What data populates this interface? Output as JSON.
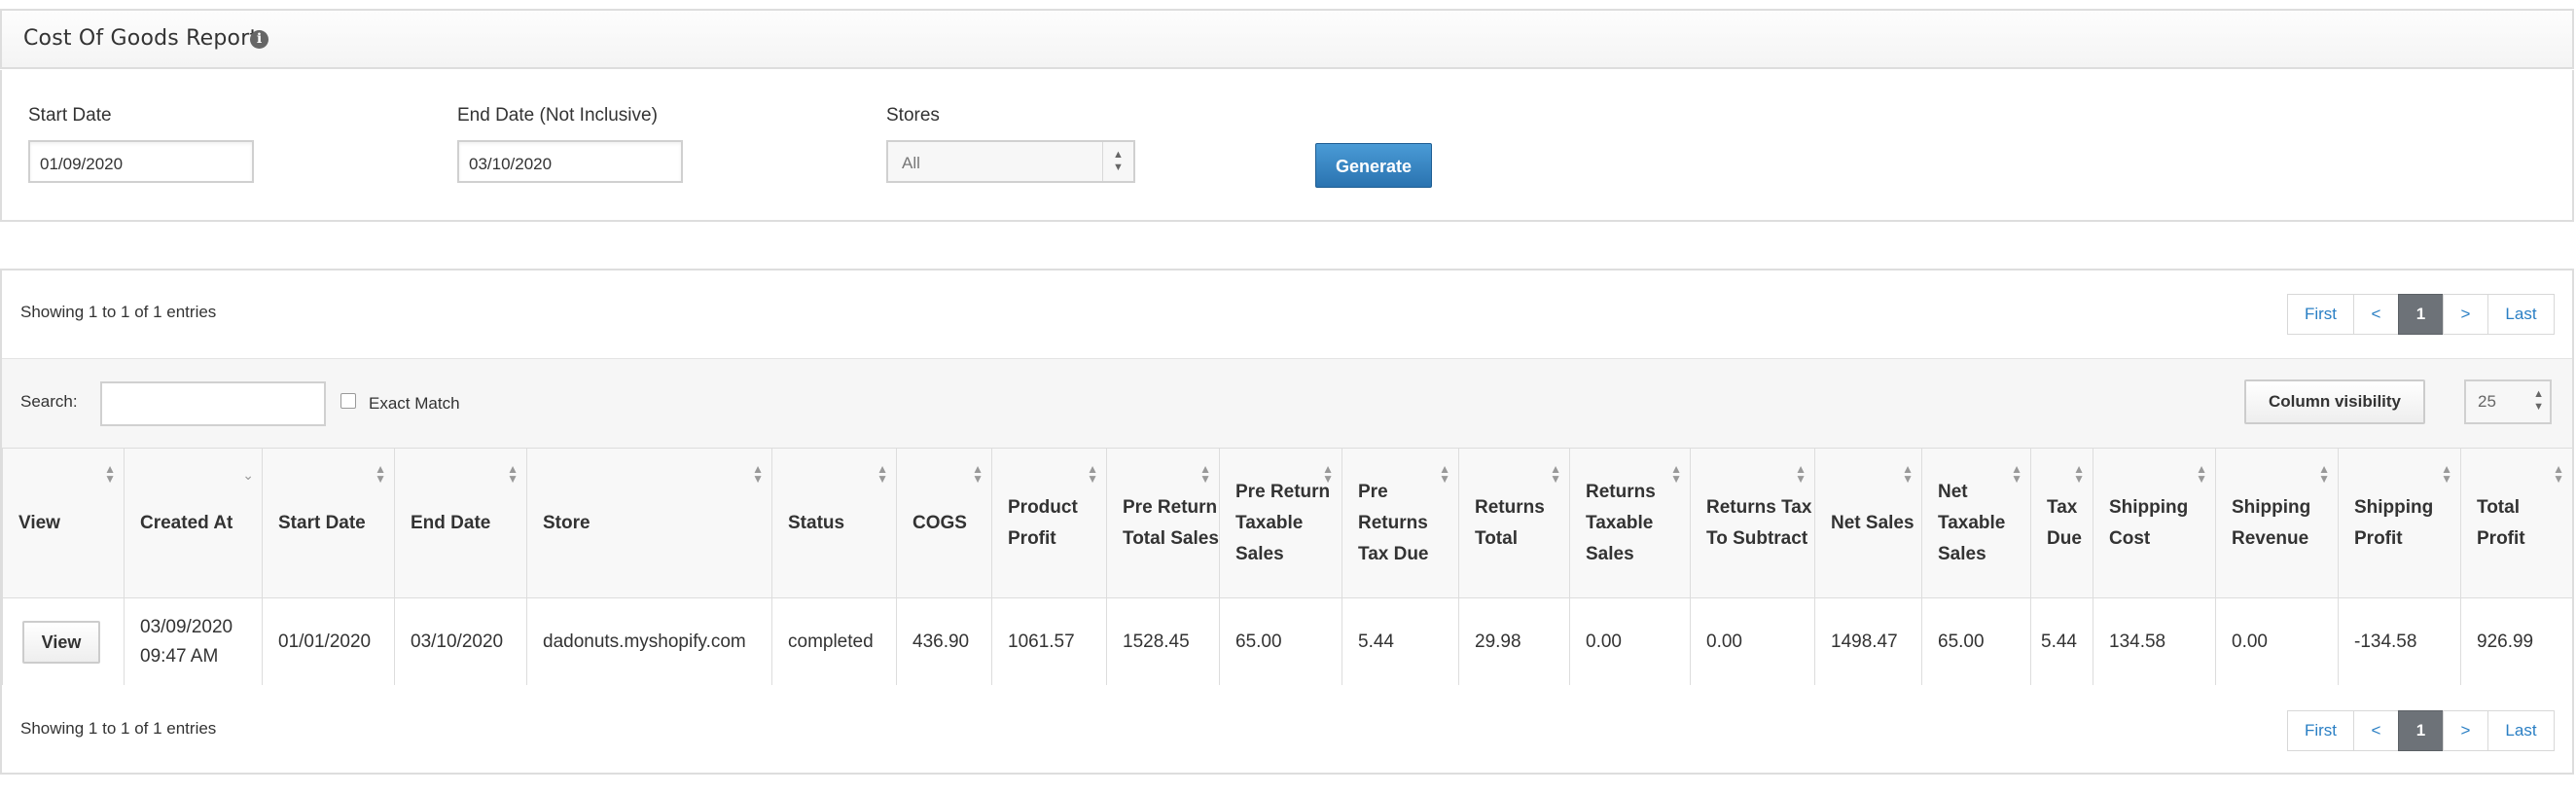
{
  "header": {
    "title": "Cost Of Goods Report",
    "info_icon": "info-icon"
  },
  "form": {
    "start_label": "Start Date",
    "start_value": "01/09/2020",
    "end_label": "End Date (Not Inclusive)",
    "end_value": "03/10/2020",
    "stores_label": "Stores",
    "stores_value": "All",
    "generate_label": "Generate"
  },
  "table": {
    "info_top": "Showing 1 to 1 of 1 entries",
    "info_bottom": "Showing 1 to 1 of 1 entries",
    "pager": {
      "first": "First",
      "prev": "<",
      "current": "1",
      "next": ">",
      "last": "Last"
    },
    "search_label": "Search:",
    "search_value": "",
    "exact_match_label": "Exact Match",
    "column_visibility_label": "Column visibility",
    "page_length": "25",
    "columns": [
      "View",
      "Created At",
      "Start Date",
      "End Date",
      "Store",
      "Status",
      "COGS",
      "Product Profit",
      "Pre Return Total Sales",
      "Pre Return Taxable Sales",
      "Pre Returns Tax Due",
      "Returns Total",
      "Returns Taxable Sales",
      "Returns Tax To Subtract",
      "Net Sales",
      "Net Taxable Sales",
      "Tax Due",
      "Shipping Cost",
      "Shipping Revenue",
      "Shipping Profit",
      "Total Profit"
    ],
    "rows": [
      {
        "view": "View",
        "created_date": "03/09/2020",
        "created_time": "09:47 AM",
        "start_date": "01/01/2020",
        "end_date": "03/10/2020",
        "store": "dadonuts.myshopify.com",
        "status": "completed",
        "cogs": "436.90",
        "product_profit": "1061.57",
        "pre_return_total_sales": "1528.45",
        "pre_return_taxable_sales": "65.00",
        "pre_returns_tax_due": "5.44",
        "returns_total": "29.98",
        "returns_taxable_sales": "0.00",
        "returns_tax_to_subtract": "0.00",
        "net_sales": "1498.47",
        "net_taxable_sales": "65.00",
        "tax_due": "5.44",
        "shipping_cost": "134.58",
        "shipping_revenue": "0.00",
        "shipping_profit": "-134.58",
        "total_profit": "926.99"
      }
    ]
  }
}
